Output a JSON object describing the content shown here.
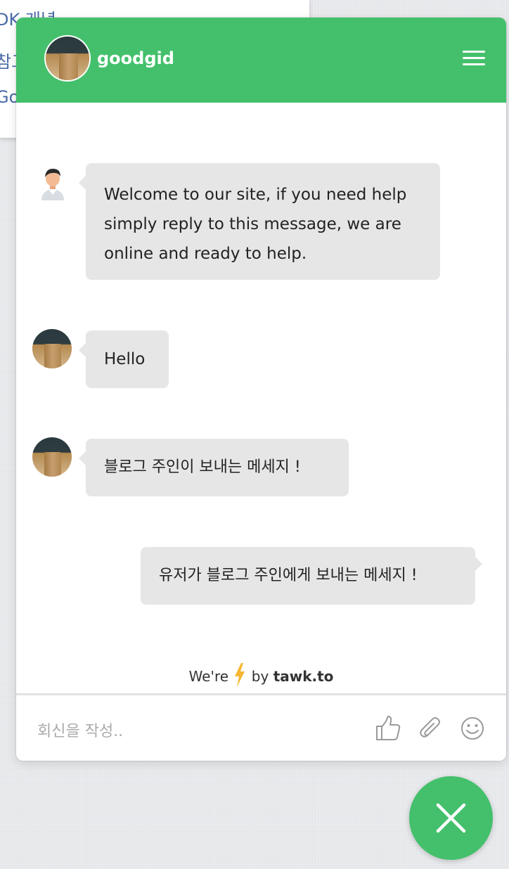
{
  "background_page": {
    "lines": [
      "DK 개념",
      "참고",
      "Go"
    ]
  },
  "header": {
    "title": "goodgid",
    "menu_icon": "hamburger-menu-icon"
  },
  "messages": [
    {
      "from": "agent",
      "text": "Welcome to our site, if you need help simply reply to this message, we are online and ready to help."
    },
    {
      "from": "agent",
      "text": "Hello"
    },
    {
      "from": "agent",
      "text": "블로그 주인이 보내는 메세지 !"
    },
    {
      "from": "visitor",
      "text": "유저가 블로그 주인에게 보내는 메세지 !"
    }
  ],
  "powered_by": {
    "prefix": "We're",
    "middle": "by",
    "brand": "tawk.to",
    "icon": "lightning-bolt-icon"
  },
  "composer": {
    "placeholder": "회신을 작성..",
    "icons": [
      "thumbs-up-icon",
      "paperclip-icon",
      "smiley-icon"
    ]
  },
  "close_button": {
    "icon": "close-icon"
  },
  "colors": {
    "brand_green": "#44c06c",
    "bubble_gray": "#e6e6e6",
    "lightning": "#f5b731"
  }
}
